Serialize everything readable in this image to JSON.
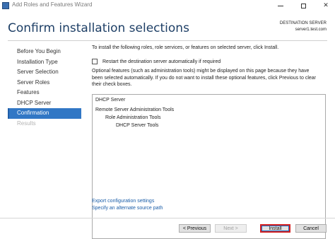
{
  "window": {
    "title": "Add Roles and Features Wizard",
    "controls": {
      "minimize": "minimize-icon",
      "maximize": "maximize-icon",
      "close": "✕"
    }
  },
  "header": {
    "title": "Confirm installation selections",
    "destination_label": "DESTINATION SERVER",
    "destination_server": "server1.test.com"
  },
  "nav": {
    "items": [
      {
        "label": "Before You Begin",
        "state": "normal"
      },
      {
        "label": "Installation Type",
        "state": "normal"
      },
      {
        "label": "Server Selection",
        "state": "normal"
      },
      {
        "label": "Server Roles",
        "state": "normal"
      },
      {
        "label": "Features",
        "state": "normal"
      },
      {
        "label": "DHCP Server",
        "state": "normal"
      },
      {
        "label": "Confirmation",
        "state": "active"
      },
      {
        "label": "Results",
        "state": "disabled"
      }
    ]
  },
  "content": {
    "intro": "To install the following roles, role services, or features on selected server, click Install.",
    "restart_label": "Restart the destination server automatically if required",
    "restart_checked": false,
    "optional_lines": [
      "Optional features (such as administration tools) might be displayed on this page because they have",
      "been selected automatically. If you do not want to install these optional features, click Previous to clear",
      "their check boxes."
    ],
    "selections": [
      {
        "text": "DHCP Server",
        "level": 0
      },
      {
        "text": "Remote Server Administration Tools",
        "level": 0
      },
      {
        "text": "Role Administration Tools",
        "level": 1
      },
      {
        "text": "DHCP Server Tools",
        "level": 2
      }
    ],
    "links": {
      "export": "Export configuration settings",
      "alternate_source": "Specify an alternate source path"
    }
  },
  "footer": {
    "previous": "< Previous",
    "next": "Next >",
    "install": "Install",
    "cancel": "Cancel"
  },
  "colors": {
    "title": "#1e3f66",
    "active_nav": "#3177c5",
    "link": "#1a5da8",
    "install_highlight": "#d42020"
  }
}
